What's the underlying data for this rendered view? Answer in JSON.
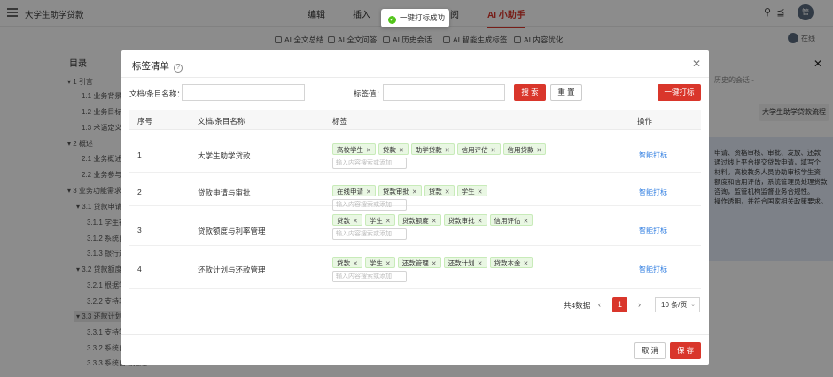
{
  "app": {
    "doc_title": "大学生助学贷款",
    "menu": [
      "编辑",
      "插入",
      "阅",
      "AI 小助手"
    ],
    "user_initial": "管"
  },
  "subbar": {
    "items": [
      "AI 全文总结",
      "AI 全文问答",
      "AI 历史会话",
      "AI 智能生成标签",
      "AI 内容优化"
    ],
    "online_label": "在线"
  },
  "toc": {
    "title": "目录",
    "items": [
      "▾ 1 引言",
      "1.1 业务背景",
      "1.2 业务目标",
      "1.3 术语定义",
      "▾ 2 概述",
      "2.1 业务概述",
      "2.2 业务参与",
      "▾ 3 业务功能需求",
      "▾ 3.1 贷款申请",
      "3.1.1 学生在",
      "3.1.2 系统自",
      "3.1.3 银行通",
      "▾ 3.2 贷款额度",
      "3.2.1 根据学",
      "3.2.2 支持其",
      "▾ 3.3 还款计划",
      "3.3.1 支持学",
      "3.3.2 系统自",
      "3.3.3 系统自动推送"
    ]
  },
  "right_panel": {
    "history_text": "历史的会话 -",
    "chip": "大学生助学贷款流程",
    "answer_lines": [
      "申请、资格审核、审批、发放、还款",
      "通过线上平台提交贷款申请，填写个",
      "材料。高校教务人员协助审核学生资",
      "额度和信用评估，系统管理员处理贷款",
      "咨询，监管机构监督业务合规性。",
      "操作透明，并符合国家相关政策要求。"
    ]
  },
  "toast": {
    "message": "一键打标成功"
  },
  "modal": {
    "title": "标签清单",
    "filter": {
      "name_label": "文档/条目名称：",
      "name_value": "",
      "tag_label": "标签值：",
      "tag_value": "",
      "search_label": "搜 索",
      "reset_label": "重 置",
      "batch_label": "一键打标"
    },
    "columns": [
      "序号",
      "文档/条目名称",
      "标签",
      "操作"
    ],
    "tag_input_placeholder": "输入内容搜索或添加",
    "rows": [
      {
        "index": "1",
        "name": "大学生助学贷款",
        "tags": [
          "高校学生",
          "贷款",
          "助学贷款",
          "信用评估",
          "信用贷款"
        ],
        "action": "智能打标"
      },
      {
        "index": "2",
        "name": "贷款申请与审批",
        "tags": [
          "在线申请",
          "贷款审批",
          "贷款",
          "学生"
        ],
        "action": "智能打标"
      },
      {
        "index": "3",
        "name": "贷款额度与利率管理",
        "tags": [
          "贷款",
          "学生",
          "贷款额度",
          "贷款审批",
          "信用评估"
        ],
        "action": "智能打标"
      },
      {
        "index": "4",
        "name": "还款计划与还款管理",
        "tags": [
          "贷款",
          "学生",
          "还款管理",
          "还款计划",
          "贷款本金"
        ],
        "action": "智能打标"
      }
    ],
    "pagination": {
      "total_label": "共4数据",
      "current_page": "1",
      "page_size": "10 条/页"
    },
    "footer": {
      "cancel_label": "取 消",
      "save_label": "保 存"
    }
  },
  "colors": {
    "accent": "#d9362b",
    "link": "#2f7de1",
    "tag_bg": "#e9f7e3",
    "success": "#52c41a"
  }
}
